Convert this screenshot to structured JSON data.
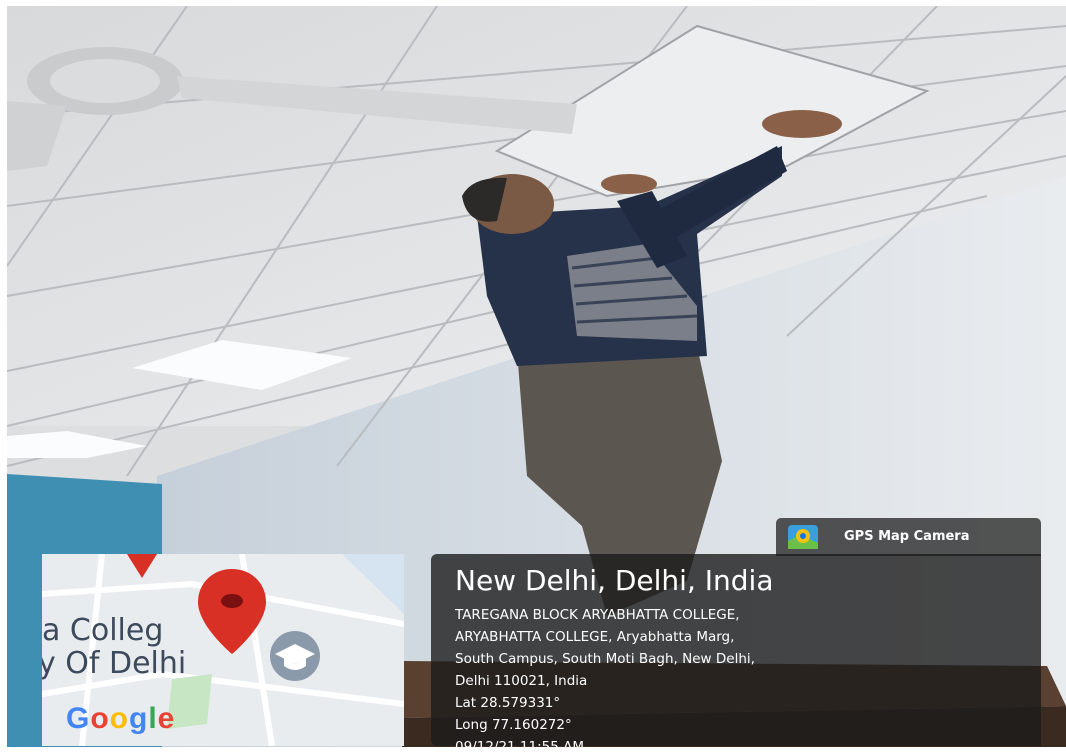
{
  "scene": {
    "icons": [
      "ceiling-fan-icon",
      "ceiling-light-icon"
    ]
  },
  "map": {
    "line1": "a Colleg",
    "line2": "y Of Delhi",
    "google_logo": [
      "G",
      "o",
      "o",
      "g",
      "l",
      "e"
    ],
    "google_colors": [
      "#4285F4",
      "#EA4335",
      "#FBBC05",
      "#4285F4",
      "#34A853",
      "#EA4335"
    ],
    "pin_color": "#d93025"
  },
  "badge": {
    "label": "GPS Map Camera"
  },
  "info": {
    "title": "New Delhi, Delhi, India",
    "address_lines": [
      "TAREGANA BLOCK ARYABHATTA COLLEGE,",
      "ARYABHATTA COLLEGE, Aryabhatta Marg,",
      "South Campus, South Moti Bagh, New Delhi,",
      "Delhi 110021, India"
    ],
    "lat": "Lat 28.579331°",
    "long": "Long 77.160272°",
    "datetime": "09/12/21 11:55 AM"
  }
}
